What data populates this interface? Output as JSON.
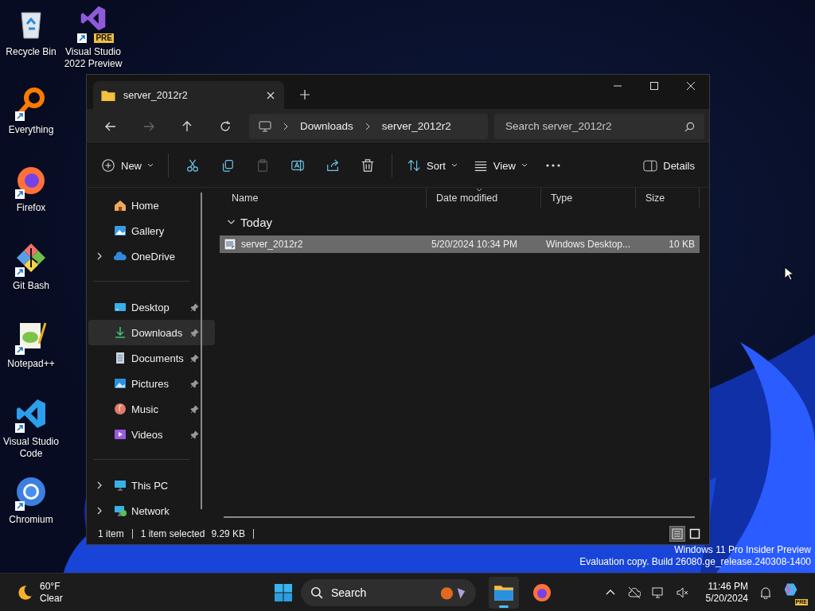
{
  "desktop_icons": [
    {
      "label": "Recycle Bin",
      "kind": "recycle",
      "shortcut": false
    },
    {
      "label": "Visual Studio 2022 Preview",
      "kind": "vs",
      "shortcut": true,
      "badge": "PRE"
    },
    {
      "label": "Everything",
      "kind": "everything",
      "shortcut": true
    },
    {
      "label": "Firefox",
      "kind": "firefox",
      "shortcut": true
    },
    {
      "label": "Git Bash",
      "kind": "git",
      "shortcut": true
    },
    {
      "label": "Notepad++",
      "kind": "notepad",
      "shortcut": true
    },
    {
      "label": "Visual Studio Code",
      "kind": "vscode",
      "shortcut": true
    },
    {
      "label": "Chromium",
      "kind": "chromium",
      "shortcut": true
    }
  ],
  "desktop_notice": [
    "Windows 11 Pro Insider Preview",
    "Evaluation copy. Build 26080.ge_release.240308-1400"
  ],
  "window": {
    "tab": {
      "title": "server_2012r2"
    },
    "nav_buttons": [
      {
        "kind": "back",
        "disabled": false
      },
      {
        "kind": "forward",
        "disabled": true
      },
      {
        "kind": "up",
        "disabled": false
      },
      {
        "kind": "refresh",
        "disabled": false
      }
    ],
    "breadcrumb": [
      "Downloads",
      "server_2012r2"
    ],
    "search": {
      "placeholder": "Search server_2012r2"
    },
    "commands": [
      {
        "kind": "new",
        "label": "New",
        "dropdown": true,
        "disabled": false
      },
      {
        "kind": "cut",
        "disabled": false
      },
      {
        "kind": "copy",
        "disabled": false
      },
      {
        "kind": "paste",
        "disabled": true
      },
      {
        "kind": "rename",
        "disabled": false
      },
      {
        "kind": "share",
        "disabled": false
      },
      {
        "kind": "delete",
        "disabled": false
      },
      {
        "kind": "sort",
        "label": "Sort",
        "dropdown": true,
        "disabled": false
      },
      {
        "kind": "view",
        "label": "View",
        "dropdown": true,
        "disabled": false
      },
      {
        "kind": "more",
        "disabled": false
      }
    ],
    "details_button": {
      "label": "Details"
    },
    "sidebar": {
      "groups": [
        [
          {
            "label": "Home",
            "kind": "home",
            "expandable": false,
            "pinned": false,
            "selected": false
          },
          {
            "label": "Gallery",
            "kind": "gallery",
            "expandable": false,
            "pinned": false,
            "selected": false
          },
          {
            "label": "OneDrive",
            "kind": "cloud",
            "expandable": true,
            "pinned": false,
            "selected": false
          }
        ],
        [
          {
            "label": "Desktop",
            "kind": "desktop",
            "expandable": false,
            "pinned": true,
            "selected": false
          },
          {
            "label": "Downloads",
            "kind": "downloads",
            "expandable": false,
            "pinned": true,
            "selected": true
          },
          {
            "label": "Documents",
            "kind": "documents",
            "expandable": false,
            "pinned": true,
            "selected": false
          },
          {
            "label": "Pictures",
            "kind": "pictures",
            "expandable": false,
            "pinned": true,
            "selected": false
          },
          {
            "label": "Music",
            "kind": "music",
            "expandable": false,
            "pinned": true,
            "selected": false
          },
          {
            "label": "Videos",
            "kind": "videos",
            "expandable": false,
            "pinned": true,
            "selected": false
          }
        ],
        [
          {
            "label": "This PC",
            "kind": "pc",
            "expandable": true,
            "pinned": false,
            "selected": false
          },
          {
            "label": "Network",
            "kind": "network",
            "expandable": true,
            "pinned": false,
            "selected": false
          }
        ]
      ]
    },
    "columns": [
      {
        "label": "Name",
        "sorted": false
      },
      {
        "label": "Date modified",
        "sorted": true
      },
      {
        "label": "Type",
        "sorted": false
      },
      {
        "label": "Size",
        "sorted": false
      }
    ],
    "file_groups": [
      {
        "label": "Today",
        "expanded": true,
        "files": [
          {
            "name": "server_2012r2",
            "date": "5/20/2024 10:34 PM",
            "type": "Windows Desktop...",
            "size": "10 KB",
            "selected": true
          }
        ]
      }
    ],
    "status_bar": {
      "count": "1 item",
      "selection": "1 item selected",
      "size": "9.29 KB"
    },
    "view_modes": [
      {
        "kind": "details",
        "selected": true
      },
      {
        "kind": "tiles",
        "selected": false
      }
    ]
  },
  "taskbar": {
    "weather": {
      "temperature": "60°F",
      "condition": "Clear"
    },
    "search": {
      "label": "Search"
    },
    "apps": [
      {
        "kind": "explorer",
        "active": true
      },
      {
        "kind": "firefox",
        "active": false
      }
    ],
    "tray_icons": [
      {
        "kind": "chevron"
      },
      {
        "kind": "cloud-off"
      },
      {
        "kind": "monitor"
      },
      {
        "kind": "speaker-muted"
      }
    ],
    "clock": {
      "time": "11:46 PM",
      "date": "5/20/2024"
    },
    "copilot": {
      "badge": "PRE"
    }
  }
}
